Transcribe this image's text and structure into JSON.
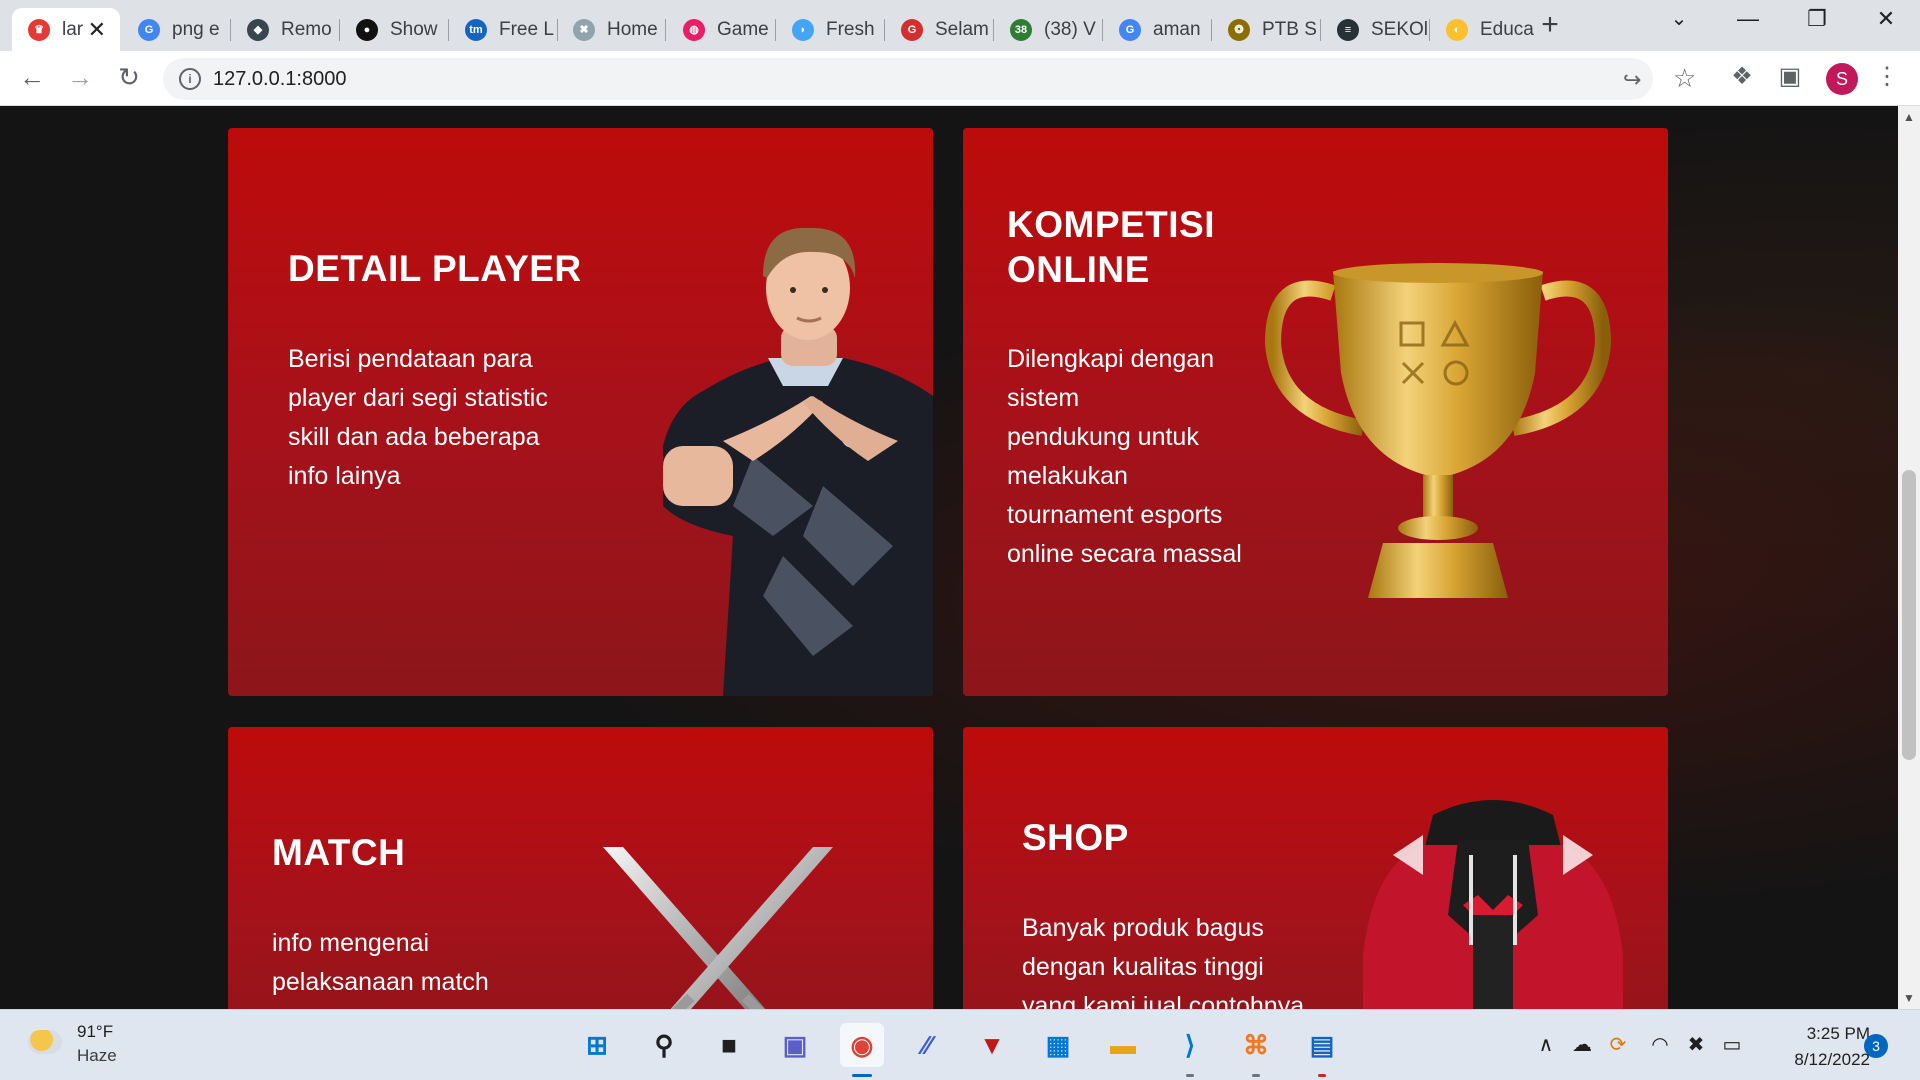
{
  "browser": {
    "tabs": [
      {
        "title": "lar",
        "active": true,
        "color": "#e53935",
        "glyph": "♛"
      },
      {
        "title": "png e",
        "color": "#4285f4",
        "glyph": "G"
      },
      {
        "title": "Remo",
        "color": "#37474f",
        "glyph": "◆"
      },
      {
        "title": "Show",
        "color": "#111111",
        "glyph": "●"
      },
      {
        "title": "Free L",
        "color": "#1565c0",
        "glyph": "tm"
      },
      {
        "title": "Home",
        "color": "#90a4ae",
        "glyph": "✖"
      },
      {
        "title": "Game",
        "color": "#e91e63",
        "glyph": "◍"
      },
      {
        "title": "Fresh",
        "color": "#42a5f5",
        "glyph": "◗"
      },
      {
        "title": "Selam",
        "color": "#d32f2f",
        "glyph": "G"
      },
      {
        "title": "(38) V",
        "color": "#2e7d32",
        "glyph": "38"
      },
      {
        "title": "aman",
        "color": "#4285f4",
        "glyph": "G"
      },
      {
        "title": "PTB S",
        "color": "#8d6e00",
        "glyph": "❂"
      },
      {
        "title": "SEKOl",
        "color": "#263238",
        "glyph": "≡"
      },
      {
        "title": "Educa",
        "color": "#fbc02d",
        "glyph": "◐"
      }
    ],
    "close_glyph": "✕",
    "new_tab_glyph": "+",
    "tab_search_glyph": "⌄",
    "minimize_glyph": "—",
    "restore_glyph": "❐",
    "close_window_glyph": "✕",
    "back_glyph": "←",
    "forward_glyph": "→",
    "reload_glyph": "↻",
    "site_info_glyph": "i",
    "url": "127.0.0.1:8000",
    "share_glyph": "↪",
    "star_glyph": "☆",
    "extensions_glyph": "❖",
    "sidepanel_glyph": "▣",
    "profile_initial": "S",
    "menu_glyph": "⋮"
  },
  "page": {
    "cards": [
      {
        "title_lines": [
          "DETAIL PLAYER"
        ],
        "body_lines": [
          "Berisi pendataan para",
          "player dari segi statistic",
          "skill dan ada beberapa",
          "info lainya"
        ]
      },
      {
        "title_lines": [
          "KOMPETISI",
          "ONLINE"
        ],
        "body_lines": [
          "Dilengkapi dengan",
          "sistem",
          "pendukung untuk",
          "melakukan",
          "tournament esports",
          "online secara massal"
        ]
      },
      {
        "title_lines": [
          "MATCH"
        ],
        "body_lines": [
          "info mengenai",
          "pelaksanaan match"
        ]
      },
      {
        "title_lines": [
          "SHOP"
        ],
        "body_lines": [
          "Banyak produk bagus",
          "dengan kualitas tinggi",
          "yang kami jual contohnya"
        ]
      }
    ],
    "card_color": "#bd0b0b",
    "scroll_up_glyph": "▲",
    "scroll_down_glyph": "▼"
  },
  "taskbar": {
    "weather": {
      "temp": "91°F",
      "desc": "Haze"
    },
    "apps": [
      {
        "name": "start-icon",
        "glyph": "⊞",
        "color": "#0078d4"
      },
      {
        "name": "search-icon",
        "glyph": "⚲",
        "color": "#1f1f1f"
      },
      {
        "name": "task-view-icon",
        "glyph": "■",
        "color": "#1f1f1f"
      },
      {
        "name": "chat-icon",
        "glyph": "▣",
        "color": "#5b5fc7"
      },
      {
        "name": "chrome-icon",
        "glyph": "◉",
        "color": "#db4437"
      },
      {
        "name": "app-icon",
        "glyph": "∕∕",
        "color": "#3b5bdb"
      },
      {
        "name": "mcafee-icon",
        "glyph": "▼",
        "color": "#c01818"
      },
      {
        "name": "store-icon",
        "glyph": "▦",
        "color": "#0078d4"
      },
      {
        "name": "file-explorer-icon",
        "glyph": "▬",
        "color": "#e8a317"
      },
      {
        "name": "vscode-icon",
        "glyph": "⟩",
        "color": "#0078d4"
      },
      {
        "name": "xampp-icon",
        "glyph": "⌘",
        "color": "#f47721"
      },
      {
        "name": "app-blue-icon",
        "glyph": "▤",
        "color": "#1565c0"
      }
    ],
    "tray": {
      "chevron_glyph": "∧",
      "cloud_glyph": "☁",
      "sync_glyph": "⟳",
      "wifi_glyph": "◠",
      "volume_glyph": "✖",
      "battery_glyph": "▭"
    },
    "clock": {
      "time": "3:25 PM",
      "date": "8/12/2022"
    },
    "notification_count": "3"
  }
}
